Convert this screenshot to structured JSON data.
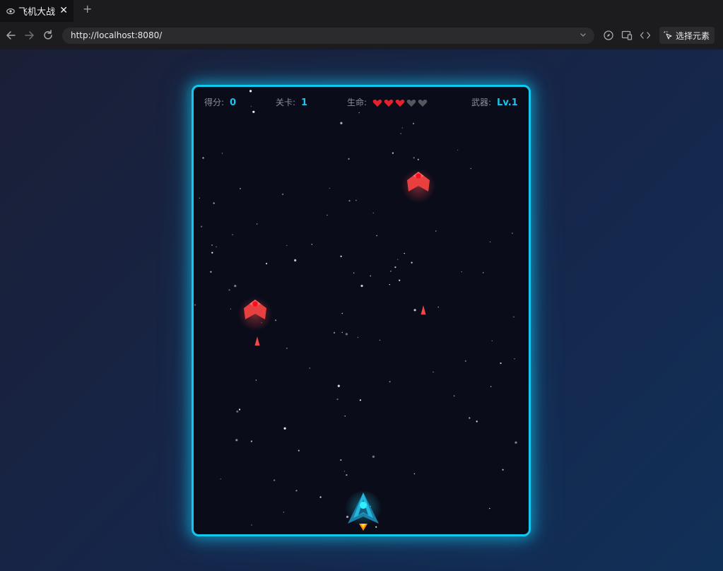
{
  "browser": {
    "tab_title": "飞机大战",
    "tab_close": "✕",
    "new_tab": "+",
    "url": "http://localhost:8080/",
    "pick_element_label": "选择元素"
  },
  "hud": {
    "score_label": "得分:",
    "score_value": "0",
    "level_label": "关卡:",
    "level_value": "1",
    "lives_label": "生命:",
    "lives_current": 3,
    "lives_max": 5,
    "weapon_label": "武器:",
    "weapon_value": "Lv.1"
  },
  "colors": {
    "frame_border": "#12c8ee",
    "hud_value": "#18c4f0",
    "heart_full": "#e8202c",
    "heart_empty": "#55575e",
    "enemy": "#e8403f",
    "player": "#20b8dc"
  },
  "icons": {
    "tab": "eye-icon",
    "back": "arrow-left-icon",
    "forward": "arrow-right-icon",
    "reload": "reload-icon",
    "heart": "heart-icon"
  }
}
